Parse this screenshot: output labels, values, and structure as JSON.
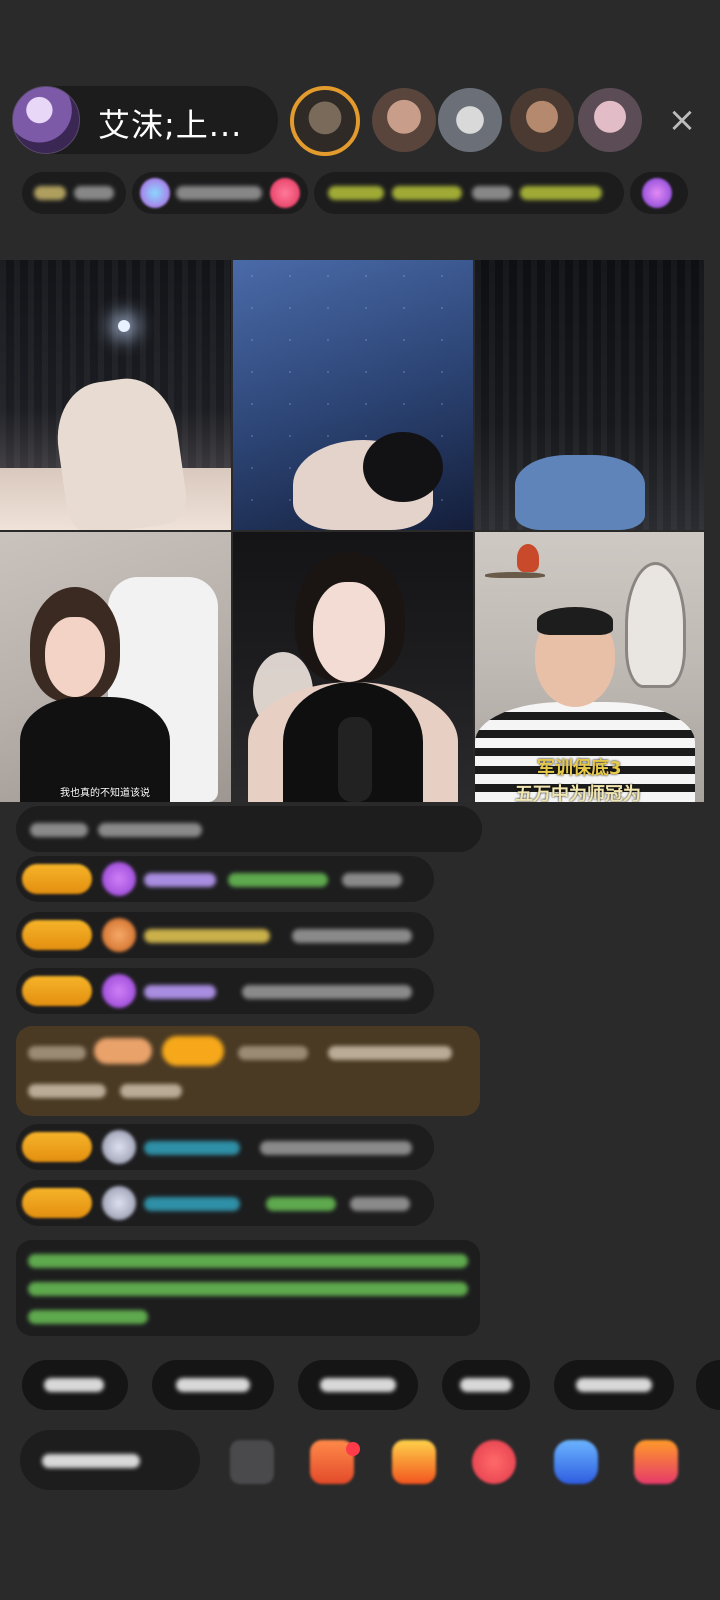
{
  "host": {
    "name": "艾沫;上...",
    "avatar_icon": "avatar-icon"
  },
  "viewers": [
    "viewer-avatar-1",
    "viewer-avatar-2",
    "viewer-avatar-3",
    "viewer-avatar-4",
    "viewer-avatar-5"
  ],
  "close_label": "×",
  "video_tiles": [
    {
      "name": "stream-tile-1"
    },
    {
      "name": "stream-tile-2"
    },
    {
      "name": "stream-tile-3"
    },
    {
      "name": "stream-tile-4",
      "caption": "我也真的不知道该说"
    },
    {
      "name": "stream-tile-5"
    },
    {
      "name": "stream-tile-6",
      "caption_line1": "军训保底3",
      "caption_line2": "五万中为师冠为"
    }
  ],
  "colors": {
    "background": "#2a2a2b",
    "chip": "#1c1c1d",
    "badge": "#f6b42a",
    "highlight_msg": "#4a3a24",
    "system_text": "#5ea84d"
  }
}
